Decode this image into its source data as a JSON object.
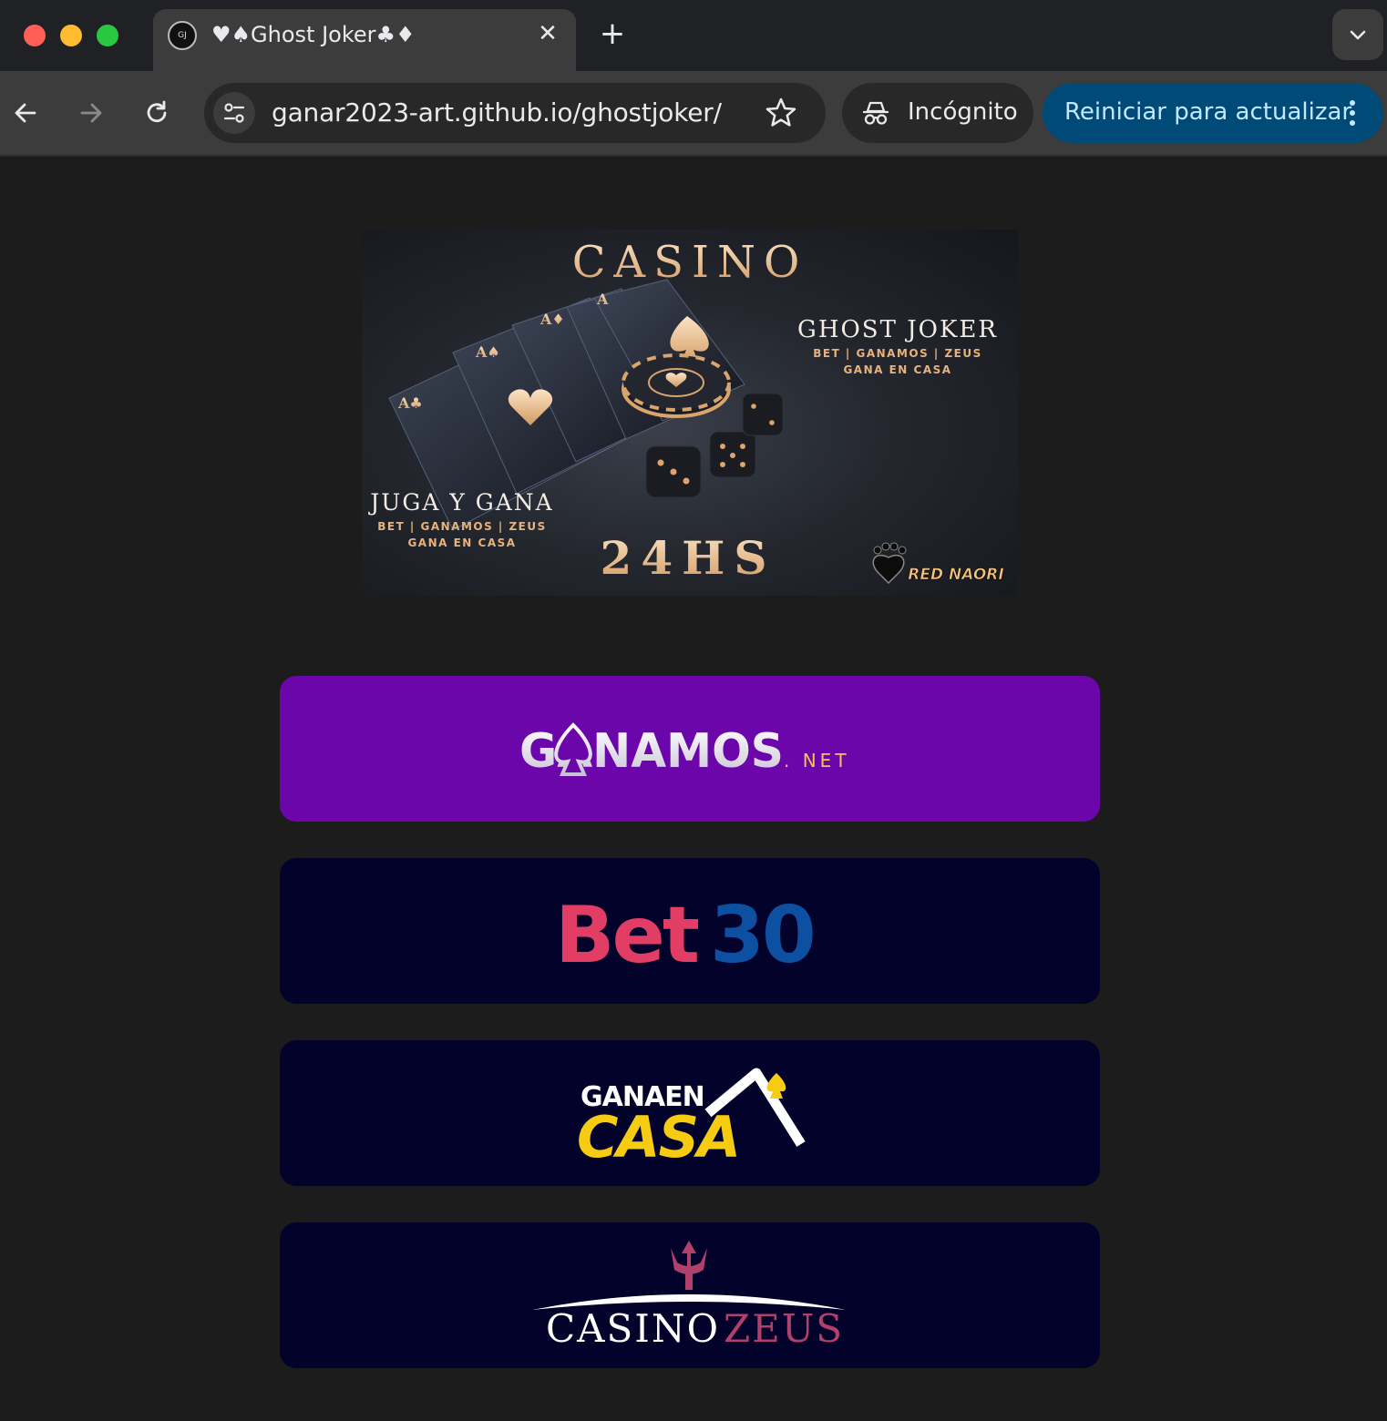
{
  "browser": {
    "tab": {
      "title": "♥♠Ghost Joker♣♦",
      "favicon": "ghost-joker-favicon",
      "close_label": "✕"
    },
    "new_tab_label": "+",
    "omnibox": {
      "url": "ganar2023-art.github.io/ghostjoker/"
    },
    "incognito_label": "Incógnito",
    "update_label": "Reiniciar para actualizar",
    "colors": {
      "tabstrip": "#202124",
      "toolbar": "#3c3c3c",
      "update_button": "#004a77",
      "update_text": "#c2e7ff"
    }
  },
  "page": {
    "banner": {
      "heading": "CASINO",
      "brand": "GHOST JOKER",
      "brand_sub1": "BET | GANAMOS | ZEUS",
      "brand_sub2": "GANA EN CASA",
      "tagline": "JUGA Y GANA",
      "tagline_sub1": "BET | GANAMOS | ZEUS",
      "tagline_sub2": "GANA EN CASA",
      "hours": "24HS",
      "credit": "RED NAORI"
    },
    "links": [
      {
        "name": "ganamos",
        "logo_main": "GANAMOS",
        "logo_suffix": ". NET",
        "bg": "#6a06aa"
      },
      {
        "name": "bet30",
        "logo_a": "Bet",
        "logo_b": "30",
        "bg": "#02022b",
        "color_a": "#e23d64",
        "color_b": "#0d4fa0"
      },
      {
        "name": "ganaencasa",
        "logo_top": "GANAEN",
        "logo_bottom": "CASA",
        "bg": "#02022b",
        "color_bottom": "#f6cc12"
      },
      {
        "name": "casinozeus",
        "logo_a": "CASINO",
        "logo_b": "ZEUS",
        "bg": "#02022b",
        "color_b": "#b2406c"
      }
    ]
  }
}
